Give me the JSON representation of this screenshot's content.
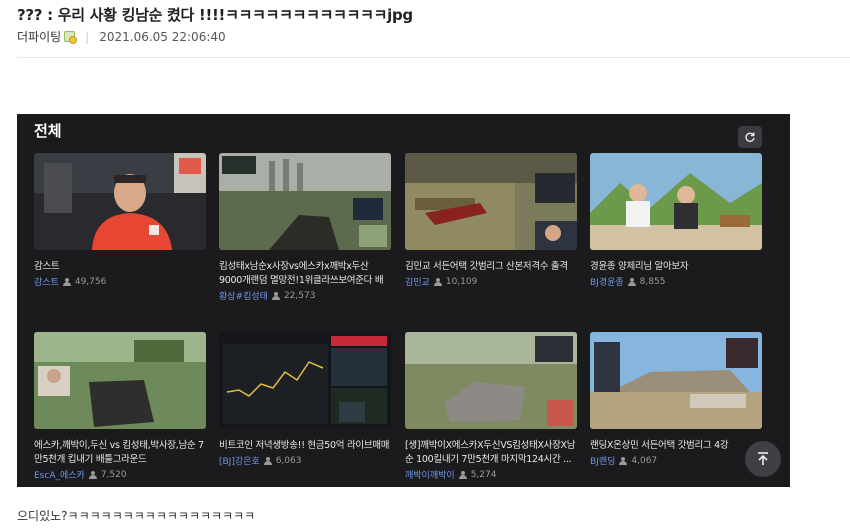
{
  "post": {
    "title": "??? : 우리 사황 킹남순 켰다 !!!!ㅋㅋㅋㅋㅋㅋㅋㅋㅋㅋㅋㅋjpg",
    "author": "더파이팅",
    "separator": "|",
    "date": "2021.06.05 22:06:40",
    "level_icon": "level-badge-icon"
  },
  "panel": {
    "title": "전체",
    "refresh_icon": "refresh-icon",
    "scroll_top_icon": "arrow-up-icon"
  },
  "cards": [
    {
      "title": "감스트",
      "streamer": "감스트",
      "viewers": "49,756",
      "thumb": "streamer-cam"
    },
    {
      "title": "킴성태x남순x사장vs에스카x깨박x두산 9000개랜덤 멸망전!1위클라쓰보여준다 배틀...",
      "streamer": "황상#킴성태",
      "viewers": "22,573",
      "thumb": "battleground"
    },
    {
      "title": "김민교 서든어택 갓범리그 산본저격수 출격",
      "streamer": "김민교",
      "viewers": "10,109",
      "thumb": "fps"
    },
    {
      "title": "경윤종 양체리님 알아보자",
      "streamer": "BJ경윤종",
      "viewers": "8,855",
      "thumb": "talk"
    },
    {
      "title": "에스카,깨박이,두신 vs 킴성태,박사장,남순 7만5천개 킵내기 배틀그라운드",
      "streamer": "EscA_에스카",
      "viewers": "7,520",
      "thumb": "battleground2"
    },
    {
      "title": "비트코인 저녁생방송!! 현금50억 라이브매매",
      "streamer": "[BJ]강은호",
      "viewers": "6,063",
      "thumb": "trading"
    },
    {
      "title": "[생]깨박이X에스카X두신VS킴성태X사장X남순 100킬내기 7만5천개 마지막124시간 ...",
      "streamer": "깨박이깨박이",
      "viewers": "5,274",
      "thumb": "battleground3"
    },
    {
      "title": "랜딩X온상민 서든어택 갓범리그 4강",
      "streamer": "BJ랜딩",
      "viewers": "4,067",
      "thumb": "fps2"
    }
  ],
  "comment": {
    "text": "으디있노?ㅋㅋㅋㅋㅋㅋㅋㅋㅋㅋㅋㅋㅋㅋㅋㅋㅋ"
  }
}
